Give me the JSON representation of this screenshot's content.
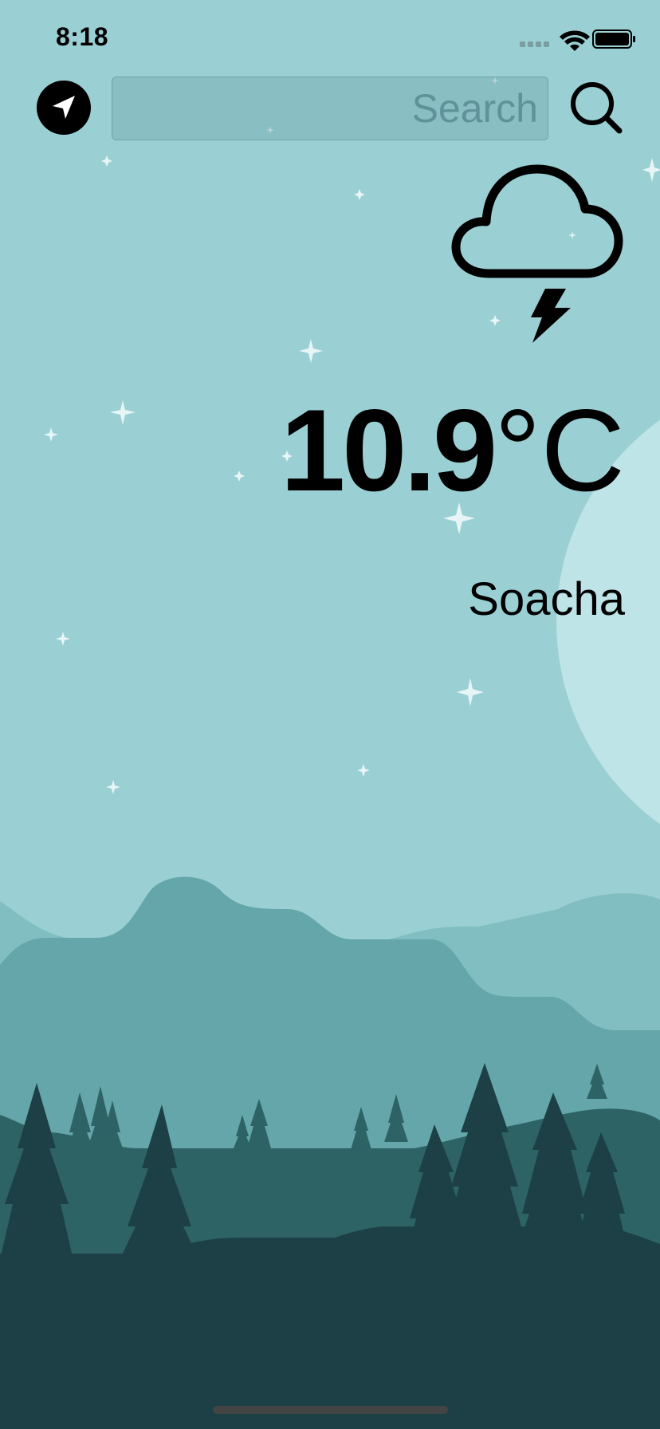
{
  "status_bar": {
    "time": "8:18",
    "signal_icon": "signal-dots-icon",
    "wifi_icon": "wifi-icon",
    "battery_icon": "battery-icon"
  },
  "toolbar": {
    "location_icon": "location-arrow-icon",
    "search_placeholder": "Search",
    "search_value": "",
    "search_icon": "magnifier-icon"
  },
  "weather": {
    "condition_icon": "cloud-lightning-icon",
    "temperature_value": "10.9",
    "temperature_unit": "°C",
    "city": "Soacha"
  },
  "colors": {
    "sky": "#9ad0d4",
    "moon": "#bee4e7",
    "mountain_far": "#81bec1",
    "mountain_mid": "#64a6a9",
    "trees_far": "#2e6366",
    "ground": "#1c4045",
    "icon": "#000000"
  }
}
